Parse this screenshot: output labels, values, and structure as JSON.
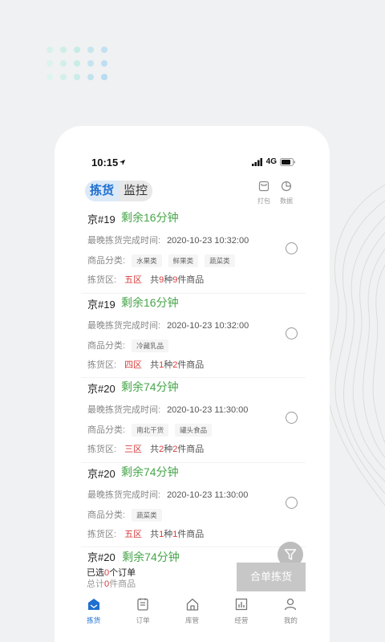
{
  "status": {
    "time": "10:15",
    "network": "4G"
  },
  "header": {
    "tabs": [
      {
        "label": "拣货",
        "active": true
      },
      {
        "label": "监控",
        "active": false
      }
    ],
    "actions": [
      {
        "label": "打包",
        "icon": "print-icon"
      },
      {
        "label": "数据",
        "icon": "pie-chart-icon"
      }
    ]
  },
  "orders": [
    {
      "title": "京#19",
      "remain": "剩余16分钟",
      "deadline_label": "最晚拣货完成时间:",
      "deadline": "2020-10-23 10:32:00",
      "category_label": "商品分类:",
      "tags": [
        "水果类",
        "鲜果类",
        "蔬菜类"
      ],
      "zone_label": "拣货区:",
      "zone": "五区",
      "count_pre": "共",
      "kinds": "9",
      "count_mid": "种",
      "pieces": "9",
      "count_post": "件商品"
    },
    {
      "title": "京#19",
      "remain": "剩余16分钟",
      "deadline_label": "最晚拣货完成时间:",
      "deadline": "2020-10-23 10:32:00",
      "category_label": "商品分类:",
      "tags": [
        "冷藏乳品"
      ],
      "zone_label": "拣货区:",
      "zone": "四区",
      "count_pre": "共",
      "kinds": "1",
      "count_mid": "种",
      "pieces": "2",
      "count_post": "件商品"
    },
    {
      "title": "京#20",
      "remain": "剩余74分钟",
      "deadline_label": "最晚拣货完成时间:",
      "deadline": "2020-10-23 11:30:00",
      "category_label": "商品分类:",
      "tags": [
        "南北干货",
        "罐头食品"
      ],
      "zone_label": "拣货区:",
      "zone": "三区",
      "count_pre": "共",
      "kinds": "2",
      "count_mid": "种",
      "pieces": "2",
      "count_post": "件商品"
    },
    {
      "title": "京#20",
      "remain": "剩余74分钟",
      "deadline_label": "最晚拣货完成时间:",
      "deadline": "2020-10-23 11:30:00",
      "category_label": "商品分类:",
      "tags": [
        "蔬菜类"
      ],
      "zone_label": "拣货区:",
      "zone": "五区",
      "count_pre": "共",
      "kinds": "1",
      "count_mid": "种",
      "pieces": "1",
      "count_post": "件商品"
    }
  ],
  "partial_order": {
    "title": "京#20",
    "remain": "剩余74分钟"
  },
  "selection": {
    "pre": "已选",
    "count": "0",
    "post": "个订单",
    "total_pre": "总计",
    "total_count": "0",
    "total_post": "件商品"
  },
  "merge_button": "合单拣货",
  "tabbar": [
    {
      "label": "拣货",
      "icon": "picking-icon",
      "active": true
    },
    {
      "label": "订单",
      "icon": "order-icon",
      "active": false
    },
    {
      "label": "库管",
      "icon": "home-icon",
      "active": false
    },
    {
      "label": "经营",
      "icon": "bar-chart-icon",
      "active": false
    },
    {
      "label": "我的",
      "icon": "user-icon",
      "active": false
    }
  ],
  "colors": {
    "accent": "#1e6fd0",
    "green": "#46a549",
    "red": "#d93b3b"
  }
}
